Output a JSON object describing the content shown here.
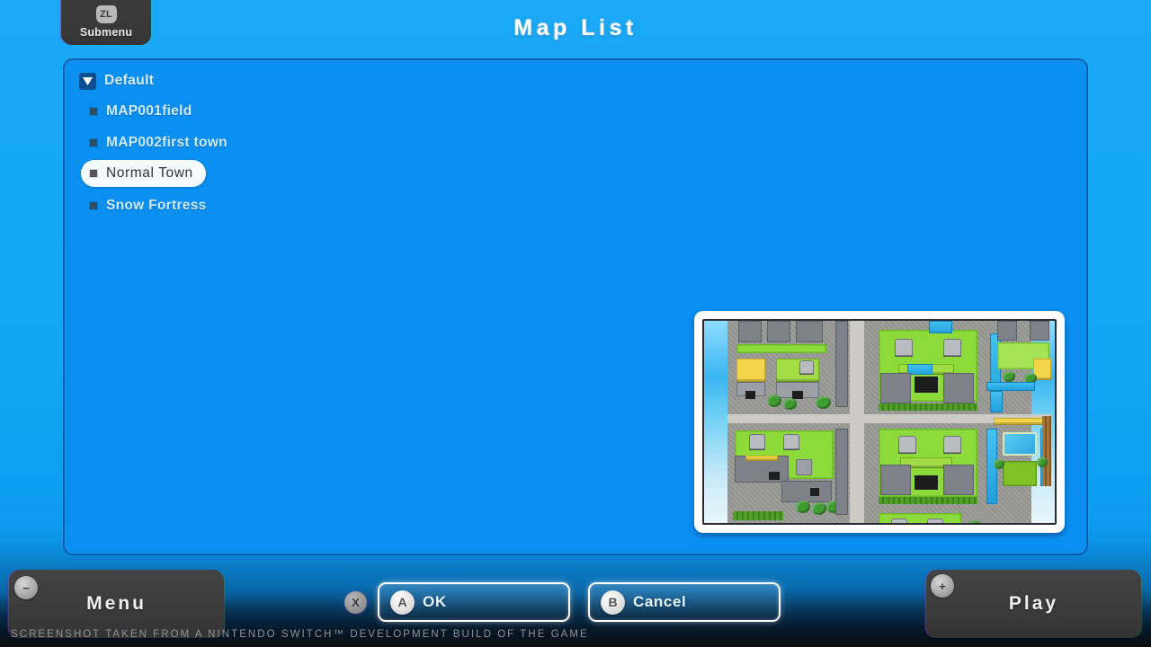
{
  "header": {
    "title": "Map List",
    "submenu": {
      "button_glyph": "ZL",
      "label": "Submenu"
    }
  },
  "map_list": {
    "group": {
      "label": "Default",
      "expanded": true,
      "disclosure_icon": "triangle-down-icon"
    },
    "items": [
      {
        "label": "MAP001field",
        "selected": false
      },
      {
        "label": "MAP002first town",
        "selected": false
      },
      {
        "label": "Normal Town",
        "selected": true
      },
      {
        "label": "Snow Fortress",
        "selected": false
      }
    ]
  },
  "preview": {
    "name": "map-preview-thumbnail",
    "alt": "Normal Town map preview"
  },
  "footer": {
    "menu": {
      "label": "Menu",
      "glyph": "minus-icon",
      "glyph_char": "−"
    },
    "play": {
      "label": "Play",
      "glyph": "plus-icon",
      "glyph_char": "+"
    },
    "ok": {
      "label": "OK",
      "button": "A"
    },
    "cancel": {
      "label": "Cancel",
      "button": "B"
    },
    "x_button": {
      "button": "X"
    }
  },
  "watermark": {
    "text": "SCREENSHOT TAKEN FROM A NINTENDO SWITCH™ DEVELOPMENT BUILD OF THE GAME"
  },
  "colors": {
    "background_blue": "#19a9f5",
    "panel_blue": "#0b8ff0",
    "panel_border": "#0a5fae",
    "selected_pill": "#f4fbff",
    "selected_text": "#333333",
    "item_text": "#cdeaff",
    "dark_button": "#3c3c3c"
  }
}
